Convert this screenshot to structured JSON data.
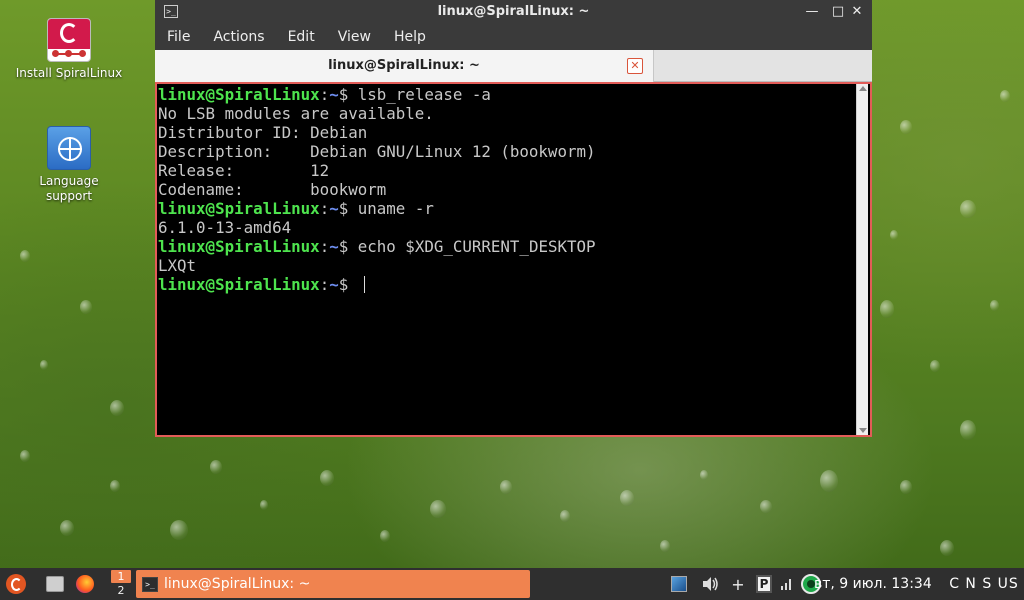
{
  "desktop": {
    "icons": [
      {
        "label": "Install SpiralLinux"
      },
      {
        "label": "Language support"
      }
    ]
  },
  "window": {
    "title": "linux@SpiralLinux: ~",
    "app_icon": ">_",
    "controls": {
      "minimize": "—",
      "maximize": "□",
      "close": "✕"
    },
    "menu": [
      "File",
      "Actions",
      "Edit",
      "View",
      "Help"
    ],
    "tab": {
      "title": "linux@SpiralLinux: ~",
      "close": "✕"
    }
  },
  "terminal": {
    "prompt_user": "linux@SpiralLinux",
    "prompt_colon": ":",
    "prompt_path": "~",
    "prompt_sign": "$ ",
    "lines": [
      {
        "kind": "cmd",
        "text": "lsb_release -a"
      },
      {
        "kind": "out",
        "text": "No LSB modules are available."
      },
      {
        "kind": "out",
        "text": "Distributor ID: Debian"
      },
      {
        "kind": "out",
        "text": "Description:    Debian GNU/Linux 12 (bookworm)"
      },
      {
        "kind": "out",
        "text": "Release:        12"
      },
      {
        "kind": "out",
        "text": "Codename:       bookworm"
      },
      {
        "kind": "cmd",
        "text": "uname -r"
      },
      {
        "kind": "out",
        "text": "6.1.0-13-amd64"
      },
      {
        "kind": "cmd",
        "text": "echo $XDG_CURRENT_DESKTOP"
      },
      {
        "kind": "out",
        "text": "LXQt"
      },
      {
        "kind": "cmd",
        "text": ""
      }
    ]
  },
  "taskbar": {
    "pager": [
      "1",
      "2"
    ],
    "task_label": "linux@SpiralLinux: ~",
    "task_icon": ">_",
    "tray": {
      "add_symbol": "+",
      "clipboard_letter": "P"
    },
    "clock": "вт, 9 июл. 13:34",
    "keyboard_indicator": "C N S US"
  },
  "colors": {
    "prompt": "#4ee44e",
    "path": "#6e8ef0",
    "terminal_bg": "#000000",
    "terminal_border": "#e25c58",
    "task_active": "#f0834f"
  }
}
